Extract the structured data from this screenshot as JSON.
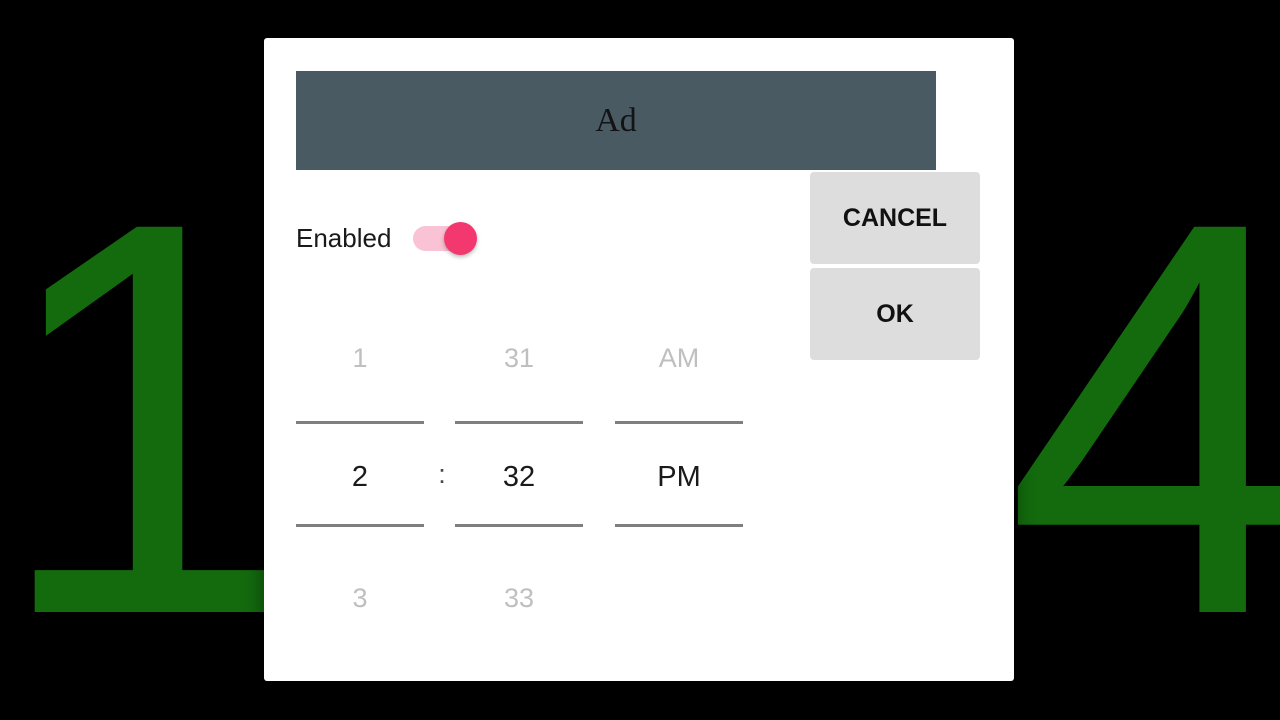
{
  "background": {
    "color": "#000000",
    "digit_color": "#136b0e",
    "left_digit": "1",
    "right_digit": "4"
  },
  "dialog": {
    "background": "#ffffff",
    "banner": {
      "label": "Ad",
      "background": "#4a5a63"
    },
    "enabled_row": {
      "label": "Enabled",
      "switch": {
        "state": "on",
        "track_color": "#f9c3d5",
        "thumb_color": "#f2386f"
      }
    },
    "buttons": {
      "cancel_label": "CANCEL",
      "ok_label": "OK",
      "background": "#dddddd"
    },
    "time_picker": {
      "separator": ":",
      "divider_color": "#7f7f7f",
      "dim_color": "#bfbfbf",
      "active_color": "#1a1a1a",
      "columns": [
        {
          "name": "hour",
          "previous": "1",
          "current": "2",
          "next": "3"
        },
        {
          "name": "minute",
          "previous": "31",
          "current": "32",
          "next": "33"
        },
        {
          "name": "period",
          "previous": "AM",
          "current": "PM",
          "next": ""
        }
      ]
    }
  }
}
